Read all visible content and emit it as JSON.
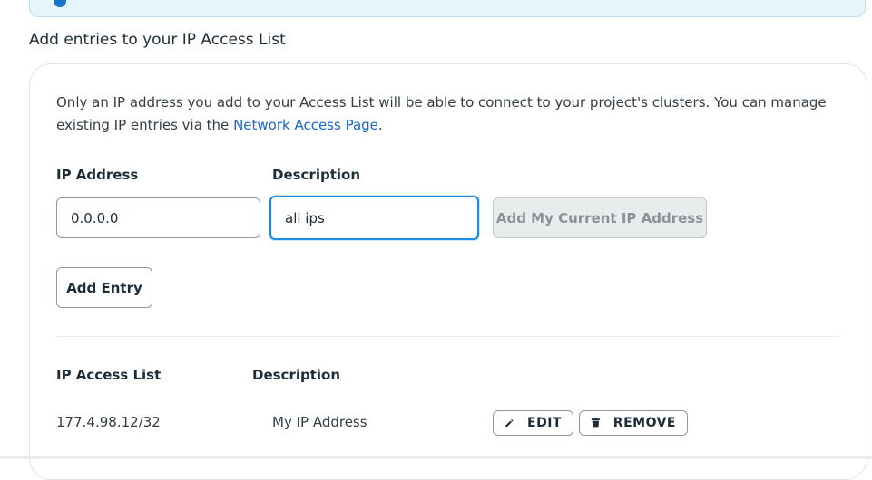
{
  "section": {
    "title": "Add entries to your IP Access List"
  },
  "intro": {
    "text": "Only an IP address you add to your Access List will be able to connect to your project's clusters. You can manage existing IP entries via the ",
    "link": "Network Access Page",
    "suffix": "."
  },
  "form": {
    "ip_label": "IP Address",
    "ip_value": "0.0.0.0",
    "description_label": "Description",
    "description_value": "all ips",
    "current_ip_button": "Add My Current IP Address",
    "add_entry_button": "Add Entry"
  },
  "access_list": {
    "header_ip": "IP Access List",
    "header_description": "Description",
    "rows": [
      {
        "ip": "177.4.98.12/32",
        "description": "My IP Address",
        "edit_label": "EDIT",
        "remove_label": "REMOVE"
      }
    ]
  },
  "colors": {
    "link": "#1a66c9",
    "focus": "#1a8de0",
    "banner_bg": "#e6f4fc"
  },
  "icons": [
    "info-icon",
    "pencil-icon",
    "trash-icon"
  ]
}
